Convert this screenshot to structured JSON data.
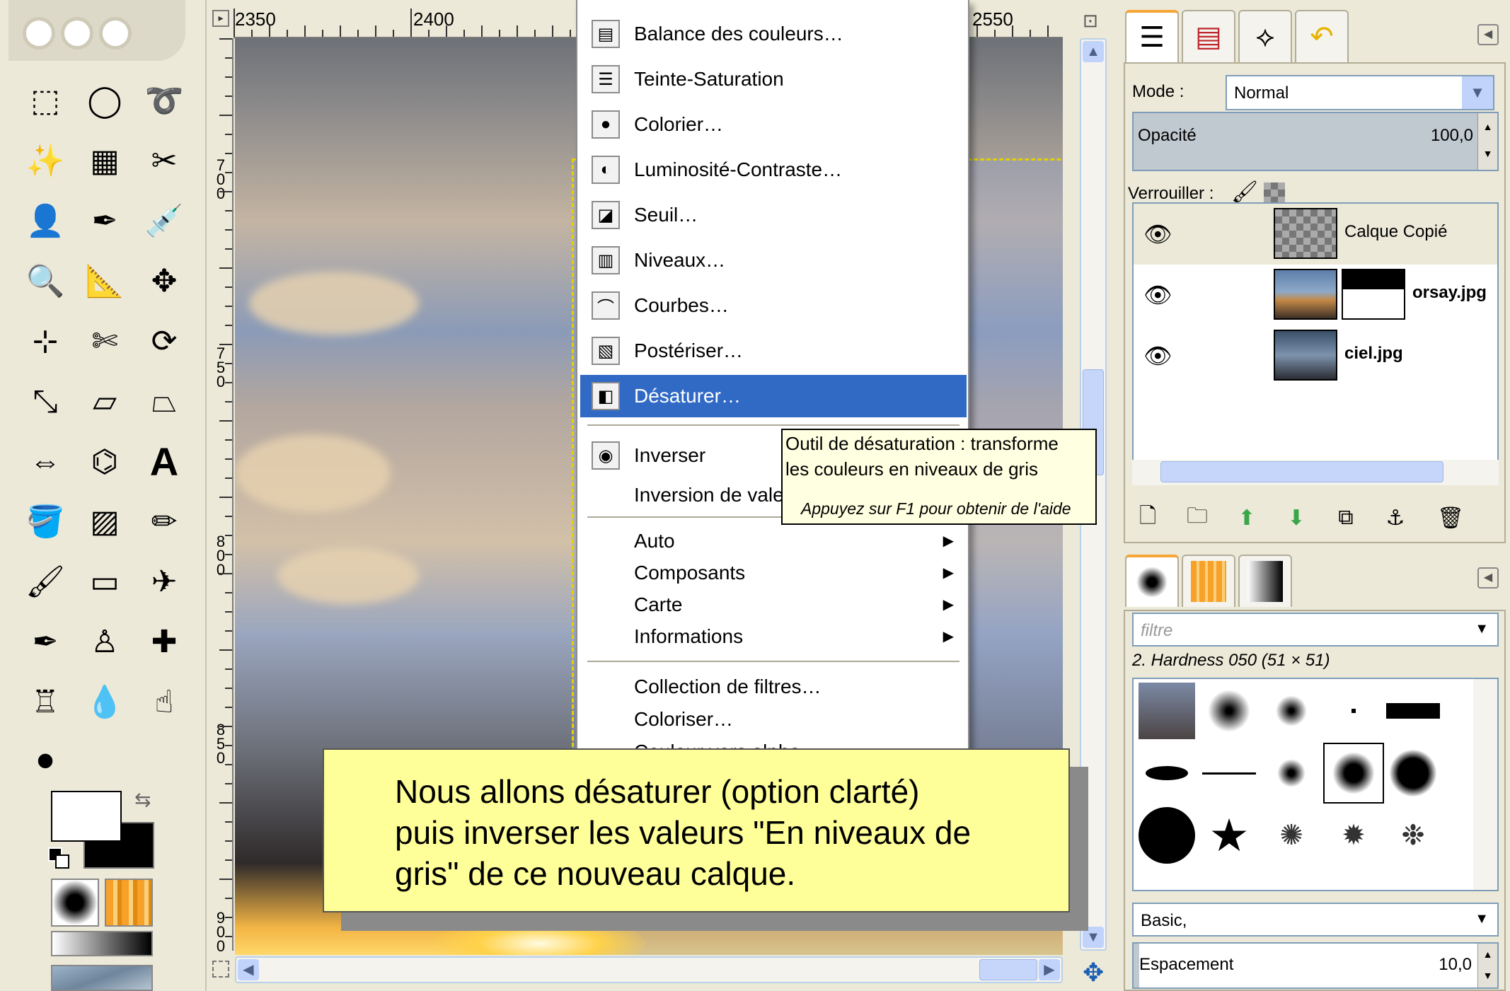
{
  "rulers": {
    "h_labels": [
      "2350",
      "2400",
      "2550"
    ],
    "v_labels": [
      "7\n0\n0",
      "7\n5\n0",
      "8\n0\n0",
      "8\n5\n0",
      "9\n0\n0"
    ]
  },
  "menu": {
    "items": [
      {
        "label": "Balance des couleurs…",
        "icon": "color-balance-icon",
        "glyph": "▤"
      },
      {
        "label": "Teinte-Saturation",
        "icon": "hue-saturation-icon",
        "glyph": "☰"
      },
      {
        "label": "Colorier…",
        "icon": "colorize-icon",
        "glyph": "●"
      },
      {
        "label": "Luminosité-Contraste…",
        "icon": "brightness-contrast-icon",
        "glyph": "◐"
      },
      {
        "label": "Seuil…",
        "icon": "threshold-icon",
        "glyph": "◪"
      },
      {
        "label": "Niveaux…",
        "icon": "levels-icon",
        "glyph": "▥"
      },
      {
        "label": "Courbes…",
        "icon": "curves-icon",
        "glyph": "⌒"
      },
      {
        "label": "Postériser…",
        "icon": "posterize-icon",
        "glyph": "▧"
      },
      {
        "label": "Désaturer…",
        "icon": "desaturate-icon",
        "glyph": "◧",
        "selected": true
      }
    ],
    "items2": [
      {
        "label": "Inverser",
        "icon": "invert-icon",
        "glyph": "◉"
      },
      {
        "label": "Inversion de valeur"
      }
    ],
    "submenus": [
      {
        "label": "Auto"
      },
      {
        "label": "Composants"
      },
      {
        "label": "Carte"
      },
      {
        "label": "Informations"
      }
    ],
    "items3": [
      {
        "label": "Collection de filtres…"
      },
      {
        "label": "Coloriser…"
      },
      {
        "label": "Couleur vers alpha…"
      }
    ]
  },
  "tooltip": {
    "line1": "Outil de désaturation : transforme",
    "line2": "les couleurs en niveaux de gris",
    "hint": "Appuyez sur F1 pour obtenir de l'aide"
  },
  "callout": {
    "line1": "Nous allons désaturer (option clarté)",
    "line2": "puis inverser les valeurs \"En niveaux de",
    "line3": "gris\" de ce nouveau calque."
  },
  "toolbox": {
    "tools": [
      {
        "name": "rect-select-tool-icon",
        "glyph": "⬚"
      },
      {
        "name": "ellipse-select-tool-icon",
        "glyph": "◯"
      },
      {
        "name": "free-select-tool-icon",
        "glyph": "➰"
      },
      {
        "name": "fuzzy-select-tool-icon",
        "glyph": "✨"
      },
      {
        "name": "select-by-color-tool-icon",
        "glyph": "▦"
      },
      {
        "name": "scissors-select-tool-icon",
        "glyph": "✂"
      },
      {
        "name": "foreground-select-tool-icon",
        "glyph": "👤"
      },
      {
        "name": "paths-tool-icon",
        "glyph": "✒"
      },
      {
        "name": "color-picker-tool-icon",
        "glyph": "💉"
      },
      {
        "name": "zoom-tool-icon",
        "glyph": "🔍"
      },
      {
        "name": "measure-tool-icon",
        "glyph": "📐"
      },
      {
        "name": "move-tool-icon",
        "glyph": "✥"
      },
      {
        "name": "align-tool-icon",
        "glyph": "⊹"
      },
      {
        "name": "crop-tool-icon",
        "glyph": "✄"
      },
      {
        "name": "rotate-tool-icon",
        "glyph": "⟳"
      },
      {
        "name": "scale-tool-icon",
        "glyph": "⤡"
      },
      {
        "name": "shear-tool-icon",
        "glyph": "▱"
      },
      {
        "name": "perspective-tool-icon",
        "glyph": "⏢"
      },
      {
        "name": "flip-tool-icon",
        "glyph": "⇔"
      },
      {
        "name": "cage-transform-tool-icon",
        "glyph": "⌬"
      },
      {
        "name": "text-tool-icon",
        "glyph": "A"
      },
      {
        "name": "bucket-fill-tool-icon",
        "glyph": "🪣"
      },
      {
        "name": "blend-tool-icon",
        "glyph": "▨"
      },
      {
        "name": "pencil-tool-icon",
        "glyph": "✏"
      },
      {
        "name": "paintbrush-tool-icon",
        "glyph": "🖌"
      },
      {
        "name": "eraser-tool-icon",
        "glyph": "▭"
      },
      {
        "name": "airbrush-tool-icon",
        "glyph": "✈"
      },
      {
        "name": "ink-tool-icon",
        "glyph": "✒"
      },
      {
        "name": "clone-tool-icon",
        "glyph": "♙"
      },
      {
        "name": "heal-tool-icon",
        "glyph": "✚"
      },
      {
        "name": "perspective-clone-tool-icon",
        "glyph": "♖"
      },
      {
        "name": "blur-sharpen-tool-icon",
        "glyph": "💧"
      },
      {
        "name": "smudge-tool-icon",
        "glyph": "☝"
      },
      {
        "name": "dodge-burn-tool-icon",
        "glyph": "⚫"
      }
    ]
  },
  "layers": {
    "mode_label": "Mode :",
    "mode_value": "Normal",
    "opacity_label": "Opacité",
    "opacity_value": "100,0",
    "opacity_fraction": 1.0,
    "lock_label": "Verrouiller :",
    "items": [
      {
        "name": "Calque Copié",
        "bold": false,
        "selected": true
      },
      {
        "name": "orsay.jpg",
        "bold": true,
        "selected": false
      },
      {
        "name": "ciel.jpg",
        "bold": true,
        "selected": false
      }
    ]
  },
  "brushes": {
    "filter_placeholder": "filtre",
    "current_brush": "2. Hardness 050 (51 × 51)",
    "preset": "Basic,",
    "spacing_label": "Espacement",
    "spacing_value": "10,0"
  },
  "colors": {
    "menu_highlight": "#316ac5",
    "callout_bg": "#ffff99",
    "tooltip_bg": "#ffffe1",
    "layer_boundary": "#e5d100"
  }
}
